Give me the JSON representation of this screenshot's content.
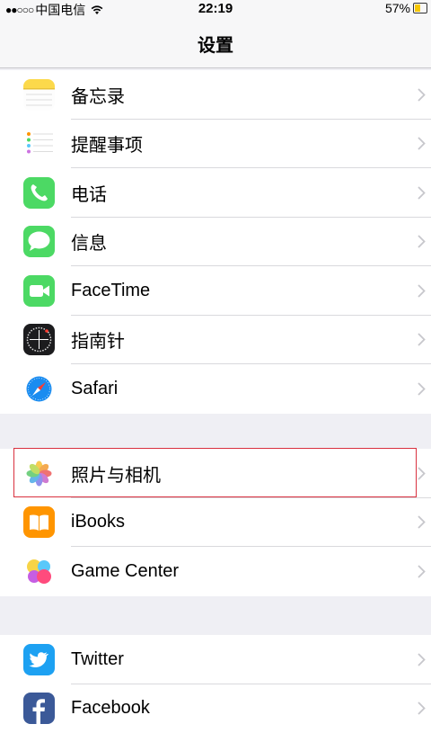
{
  "status_bar": {
    "signal": "●●○○○",
    "carrier": "中国电信",
    "time": "22:19",
    "battery_percent": "57%",
    "battery_level": 0.57
  },
  "nav": {
    "title": "设置"
  },
  "groups": [
    {
      "items": [
        {
          "label": "备忘录",
          "icon": "notes-icon"
        },
        {
          "label": "提醒事项",
          "icon": "reminders-icon"
        },
        {
          "label": "电话",
          "icon": "phone-icon"
        },
        {
          "label": "信息",
          "icon": "messages-icon"
        },
        {
          "label": "FaceTime",
          "icon": "facetime-icon"
        },
        {
          "label": "指南针",
          "icon": "compass-icon"
        },
        {
          "label": "Safari",
          "icon": "safari-icon"
        }
      ]
    },
    {
      "items": [
        {
          "label": "照片与相机",
          "icon": "photos-icon",
          "highlighted": true
        },
        {
          "label": "iBooks",
          "icon": "ibooks-icon"
        },
        {
          "label": "Game Center",
          "icon": "game-center-icon"
        }
      ]
    },
    {
      "items": [
        {
          "label": "Twitter",
          "icon": "twitter-icon"
        },
        {
          "label": "Facebook",
          "icon": "facebook-icon"
        }
      ]
    }
  ],
  "colors": {
    "background": "#efeff4",
    "highlight": "#d9313f",
    "chevron": "#c7c7cc",
    "battery": "#f6c700"
  }
}
